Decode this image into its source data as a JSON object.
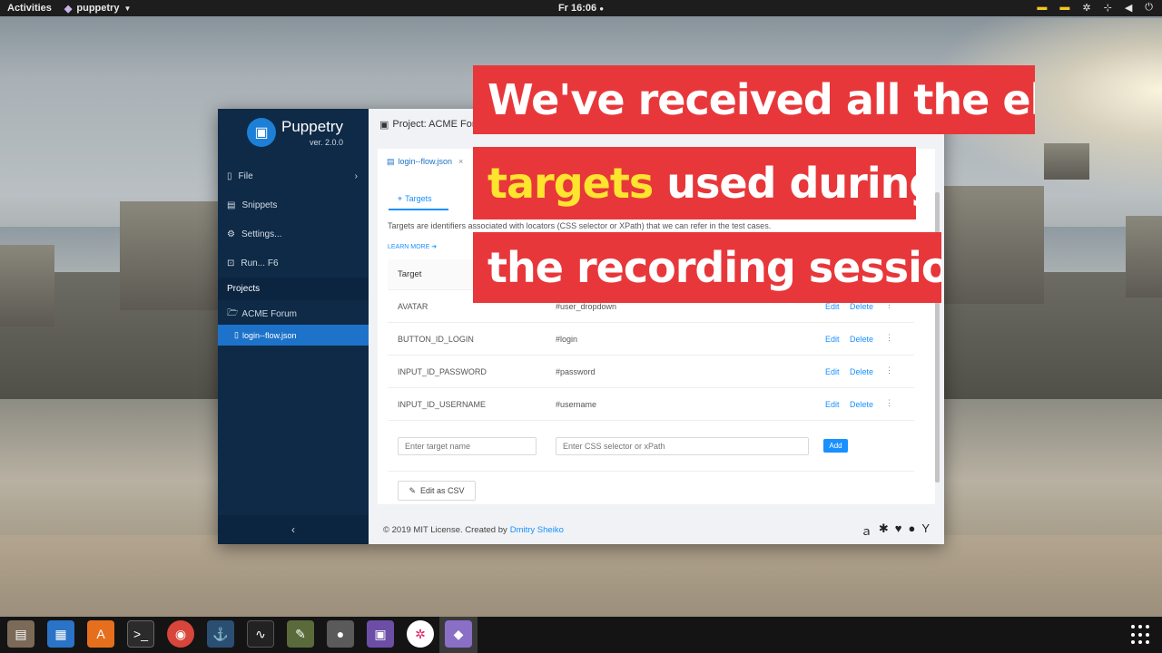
{
  "topbar": {
    "activities": "Activities",
    "app_name": "puppetry",
    "clock": "Fr 16:06"
  },
  "sidebar": {
    "brand": "Puppetry",
    "version": "ver. 2.0.0",
    "menu": [
      {
        "label": "File"
      },
      {
        "label": "Snippets"
      },
      {
        "label": "Settings..."
      },
      {
        "label": "Run... F6"
      }
    ],
    "projects_heading": "Projects",
    "project": "ACME Forum",
    "file": "login--flow.json"
  },
  "main": {
    "header": "Project: ACME Foru",
    "file_tab": "login--flow.json",
    "tab_targets": "Targets",
    "description": "Targets are identifiers associated with locators (CSS selector or XPath) that we can refer in the test cases.",
    "learn_more": "LEARN MORE ➔",
    "table": {
      "col_target": "Target",
      "rows": [
        {
          "name": "AVATAR",
          "selector": "#user_dropdown"
        },
        {
          "name": "BUTTON_ID_LOGIN",
          "selector": "#login"
        },
        {
          "name": "INPUT_ID_PASSWORD",
          "selector": "#password"
        },
        {
          "name": "INPUT_ID_USERNAME",
          "selector": "#username"
        }
      ],
      "edit_label": "Edit",
      "delete_label": "Delete"
    },
    "new_target_placeholder": "Enter target name",
    "new_selector_placeholder": "Enter CSS selector or xPath",
    "add_label": "Add",
    "csv_label": "Edit as CSV",
    "footer_text": "© 2019 MIT License. Created by",
    "footer_author": "Dmitry Sheiko"
  },
  "captions": {
    "line1": "We've received all the elem",
    "line2_highlight": "targets",
    "line2_rest": " used during",
    "line3": "the recording session"
  },
  "colors": {
    "caption_bg": "#e8373a",
    "caption_highlight": "#fde42f",
    "sidebar_bg": "#0e2a47",
    "accent": "#1890ff"
  }
}
